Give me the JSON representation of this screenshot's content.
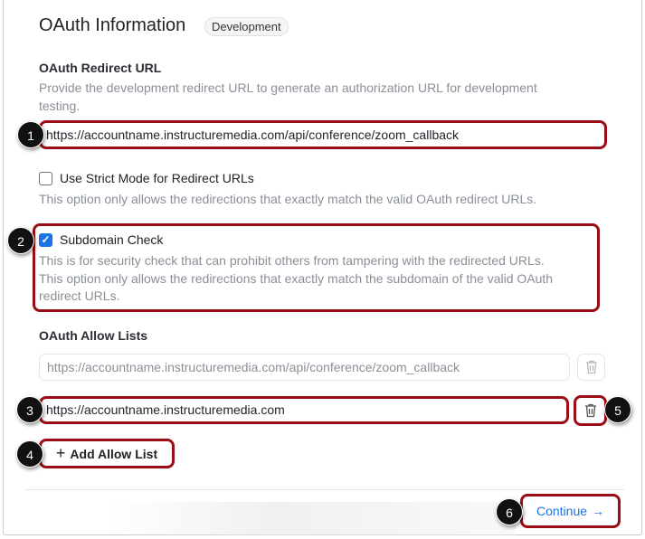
{
  "header": {
    "title": "OAuth Information",
    "badge": "Development"
  },
  "redirect": {
    "label": "OAuth Redirect URL",
    "description_1": "Provide the development redirect URL to generate an authorization URL for development",
    "description_2": "testing.",
    "value": "https://accountname.instructuremedia.com/api/conference/zoom_callback"
  },
  "strict_mode": {
    "label": "Use Strict Mode for Redirect URLs",
    "checked": false,
    "description": "This option only allows the redirections that exactly match the valid OAuth redirect URLs."
  },
  "subdomain": {
    "label": "Subdomain Check",
    "checked": true,
    "check_glyph": "✓",
    "description_1": "This is for security check that can prohibit others from tampering with the redirected URLs.",
    "description_2": "This option only allows the redirections that exactly match the subdomain of the valid OAuth",
    "description_3": "redirect URLs."
  },
  "allow_lists": {
    "label": "OAuth Allow Lists",
    "items": [
      "https://accountname.instructuremedia.com/api/conference/zoom_callback",
      "https://accountname.instructuremedia.com"
    ],
    "add_label": "Add Allow List",
    "add_icon": "+"
  },
  "footer": {
    "continue_label": "Continue",
    "continue_icon": "→"
  },
  "callouts": [
    "1",
    "2",
    "3",
    "4",
    "5",
    "6"
  ],
  "colors": {
    "accent": "#1a73e8",
    "callout_border": "#9b0d14"
  }
}
